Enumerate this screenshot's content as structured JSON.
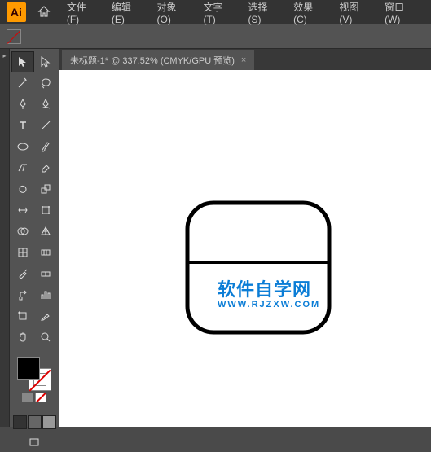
{
  "app": {
    "logo": "Ai"
  },
  "menu": {
    "file": "文件(F)",
    "edit": "编辑(E)",
    "object": "对象(O)",
    "type": "文字(T)",
    "select": "选择(S)",
    "effect": "效果(C)",
    "view": "视图(V)",
    "window": "窗口(W)"
  },
  "tab": {
    "label": "未标题-1* @ 337.52% (CMYK/GPU 预览)",
    "close": "×"
  },
  "tools": {
    "selection": "selection",
    "direct_selection": "direct-selection",
    "magic_wand": "magic-wand",
    "lasso": "lasso",
    "pen": "pen",
    "curvature": "curvature",
    "type": "type",
    "line": "line",
    "rectangle": "rectangle",
    "brush": "brush",
    "shaper": "shaper",
    "eraser": "eraser",
    "rotate": "rotate",
    "scale": "scale",
    "width": "width",
    "free_transform": "free-transform",
    "shape_builder": "shape-builder",
    "perspective": "perspective",
    "mesh": "mesh",
    "gradient": "gradient",
    "eyedropper": "eyedropper",
    "blend": "blend",
    "symbol_sprayer": "symbol-sprayer",
    "column_graph": "column-graph",
    "artboard": "artboard",
    "slice": "slice",
    "hand": "hand",
    "zoom": "zoom"
  },
  "watermark": {
    "text": "软件自学网",
    "url": "WWW.RJZXW.COM"
  },
  "colors": {
    "fill": "#000000",
    "accent": "#0b7dd6"
  }
}
